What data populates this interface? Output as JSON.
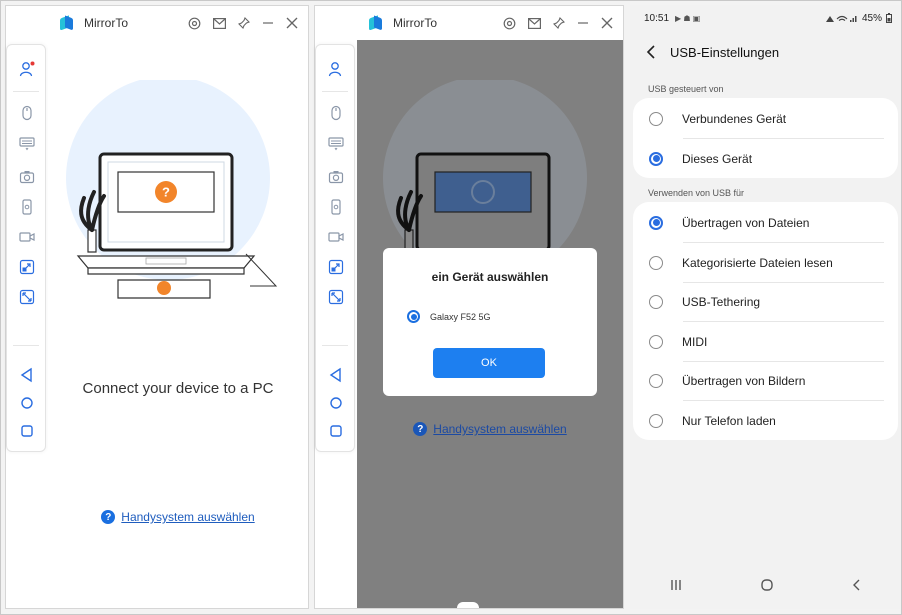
{
  "app": {
    "title": "MirrorTo"
  },
  "panel1": {
    "connect_text": "Connect your device to a PC",
    "help_icon": "?",
    "help_link": "Handysystem auswählen",
    "illustration_badge": "?"
  },
  "panel2": {
    "dialog_title": "ein Gerät auswählen",
    "device_option": "Galaxy F52 5G",
    "ok_button": "OK",
    "help_icon": "?",
    "help_link": "Handysystem auswählen"
  },
  "android": {
    "status": {
      "time": "10:51",
      "battery": "45%"
    },
    "title": "USB-Einstellungen",
    "section1": {
      "label": "USB gesteuert von",
      "options": [
        {
          "label": "Verbundenes Gerät",
          "selected": false
        },
        {
          "label": "Dieses Gerät",
          "selected": true
        }
      ]
    },
    "section2": {
      "label": "Verwenden von USB für",
      "options": [
        {
          "label": "Übertragen von Dateien",
          "selected": true
        },
        {
          "label": "Kategorisierte Dateien lesen",
          "selected": false
        },
        {
          "label": "USB-Tethering",
          "selected": false
        },
        {
          "label": "MIDI",
          "selected": false
        },
        {
          "label": "Übertragen von Bildern",
          "selected": false
        },
        {
          "label": "Nur Telefon laden",
          "selected": false
        }
      ]
    }
  },
  "colors": {
    "accent": "#1a6fe0",
    "orange": "#f2852a",
    "dim_overlay": "#808080"
  },
  "icons": [
    "user-icon",
    "mouse-icon",
    "keyboard-icon",
    "camera-icon",
    "phone-record-icon",
    "video-icon",
    "expand-icon",
    "fullscreen-icon",
    "back-triangle-icon",
    "home-circle-icon",
    "recents-square-icon",
    "settings-icon",
    "mail-icon",
    "pin-icon",
    "minimize-icon",
    "close-icon"
  ]
}
